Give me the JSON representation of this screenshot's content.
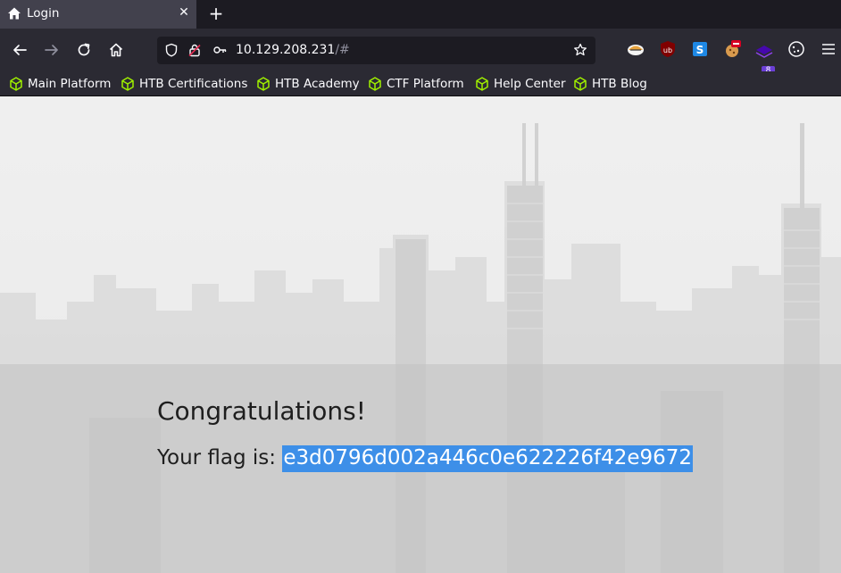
{
  "tab": {
    "title": "Login",
    "close_label": "✕",
    "new_tab_label": "+"
  },
  "address": {
    "host": "10.129.208.231",
    "path": "/#"
  },
  "extensions": {
    "badge_count": "8"
  },
  "bookmarks": [
    {
      "label": "Main Platform"
    },
    {
      "label": "HTB Certifications"
    },
    {
      "label": "HTB Academy"
    },
    {
      "label": "CTF Platform"
    },
    {
      "label": "Help Center"
    },
    {
      "label": "HTB Blog"
    }
  ],
  "page": {
    "heading": "Congratulations!",
    "flag_prefix": "Your flag is: ",
    "flag_value": "e3d0796d002a446c0e622226f42e9672"
  },
  "colors": {
    "accent_bookmark": "#9fef00",
    "selection": "#3d8fe8"
  }
}
